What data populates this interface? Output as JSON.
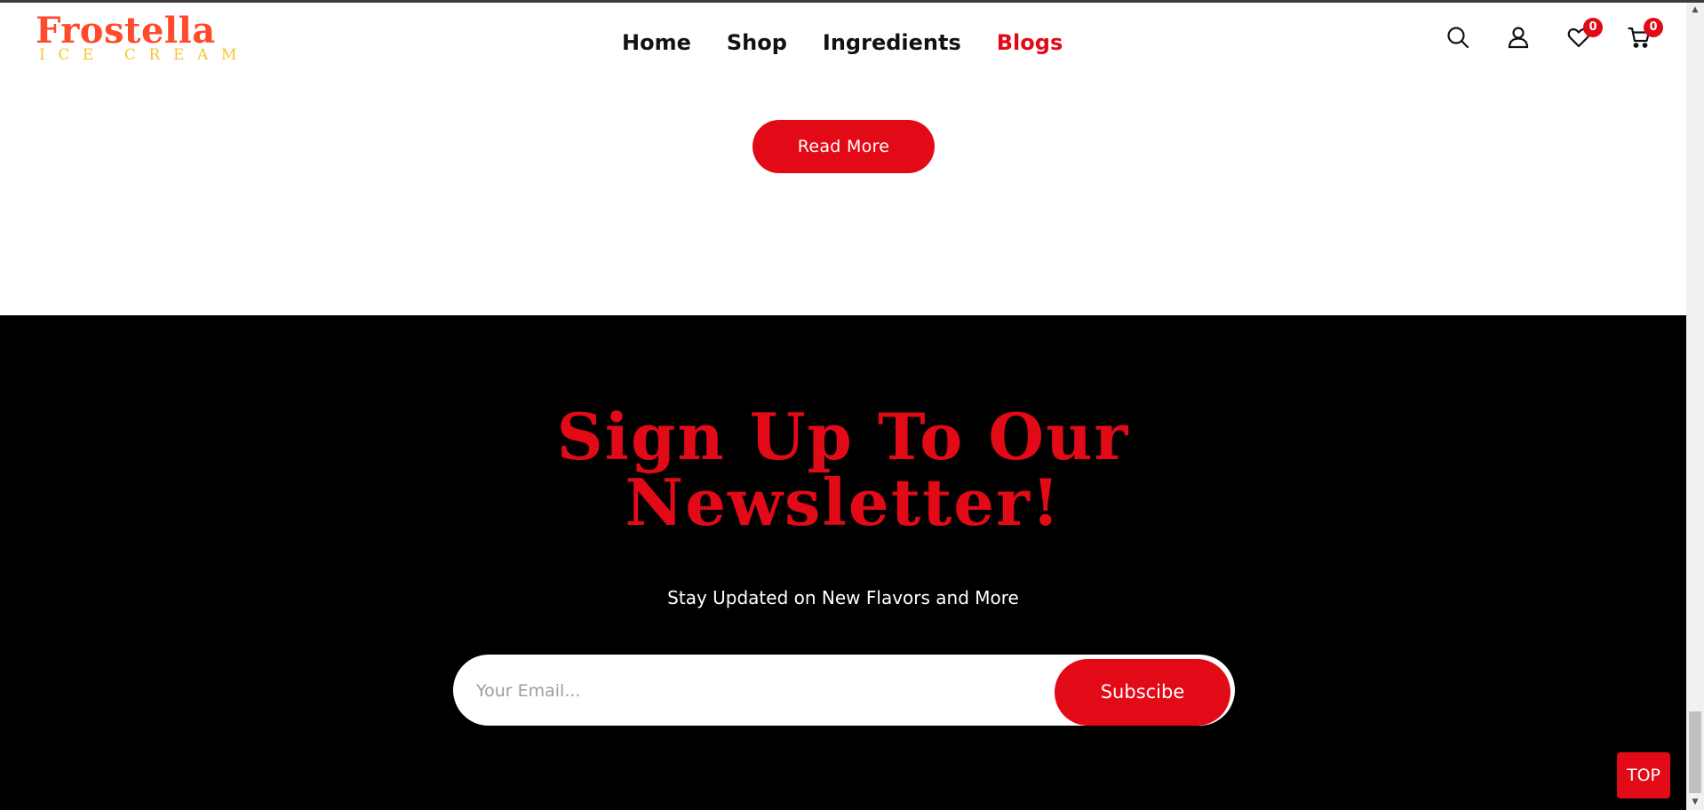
{
  "brand": {
    "name": "Frostella",
    "tagline": "ICE CREAM",
    "primary_color": "#ff4b2b",
    "secondary_color": "#f7c431"
  },
  "nav": {
    "items": [
      {
        "label": "Home",
        "active": false
      },
      {
        "label": "Shop",
        "active": false
      },
      {
        "label": "Ingredients",
        "active": false
      },
      {
        "label": "Blogs",
        "active": true
      }
    ],
    "active_color": "#e30a17"
  },
  "header_icons": {
    "search": {
      "icon": "search-icon"
    },
    "account": {
      "icon": "user-icon"
    },
    "wishlist": {
      "icon": "heart-icon",
      "count": "0"
    },
    "cart": {
      "icon": "cart-icon",
      "count": "0"
    }
  },
  "blog": {
    "read_more_label": "Read More"
  },
  "newsletter": {
    "title_line1": "Sign Up To Our",
    "title_line2": "Newsletter!",
    "subtitle": "Stay Updated on New Flavors and More",
    "email_placeholder": "Your Email...",
    "email_value": "",
    "subscribe_label": "Subscibe",
    "background_color": "#000000",
    "accent_color": "#e30a17"
  },
  "back_to_top": {
    "label": "TOP"
  }
}
